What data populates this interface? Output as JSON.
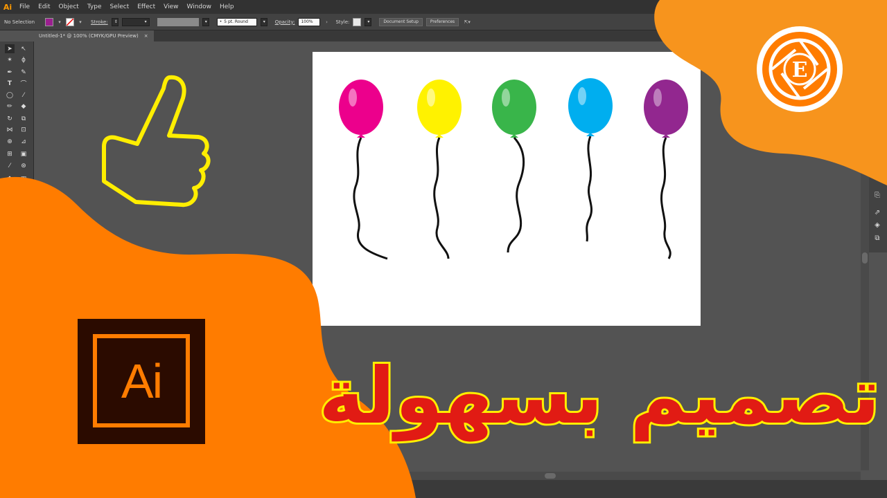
{
  "app": {
    "logo_text": "Ai"
  },
  "menu": [
    "File",
    "Edit",
    "Object",
    "Type",
    "Select",
    "Effect",
    "View",
    "Window",
    "Help"
  ],
  "control_bar": {
    "selection_label": "No Selection",
    "stroke_label": "Stroke:",
    "brush_label": "5 pt. Round",
    "opacity_label": "Opacity:",
    "opacity_value": "100%",
    "style_label": "Style:",
    "document_setup": "Document Setup",
    "preferences": "Preferences"
  },
  "document_tab": {
    "title": "Untitled-1* @ 100% (CMYK/GPU Preview)",
    "close": "×"
  },
  "colors": {
    "fill_swatch": "#9b1f8f",
    "balloon_colors": [
      "#ec008c",
      "#fff200",
      "#39b54a",
      "#00aeef",
      "#92278f"
    ],
    "accent_orange": "#ff7c00",
    "thumb_outline": "#ffee00"
  },
  "balloons": [
    {
      "color": "#ec008c"
    },
    {
      "color": "#fff200"
    },
    {
      "color": "#39b54a"
    },
    {
      "color": "#00aeef"
    },
    {
      "color": "#92278f"
    }
  ],
  "ai_logo": {
    "text": "Ai"
  },
  "brand_logo": {
    "letter": "E"
  },
  "title_text": "تصميم بسهولة",
  "icons": [
    "selection-tool-icon",
    "direct-selection-icon",
    "magic-wand-icon",
    "lasso-icon",
    "pen-tool-icon",
    "type-tool-icon",
    "line-tool-icon",
    "ellipse-tool-icon",
    "paintbrush-icon",
    "pencil-icon",
    "eraser-icon",
    "rotate-tool-icon",
    "scale-tool-icon",
    "width-tool-icon",
    "free-transform-icon",
    "shape-builder-icon",
    "perspective-grid-icon",
    "mesh-tool-icon",
    "gradient-tool-icon",
    "eyedropper-icon",
    "blend-tool-icon",
    "symbol-sprayer-icon",
    "column-graph-icon",
    "thumbs-up-icon"
  ]
}
